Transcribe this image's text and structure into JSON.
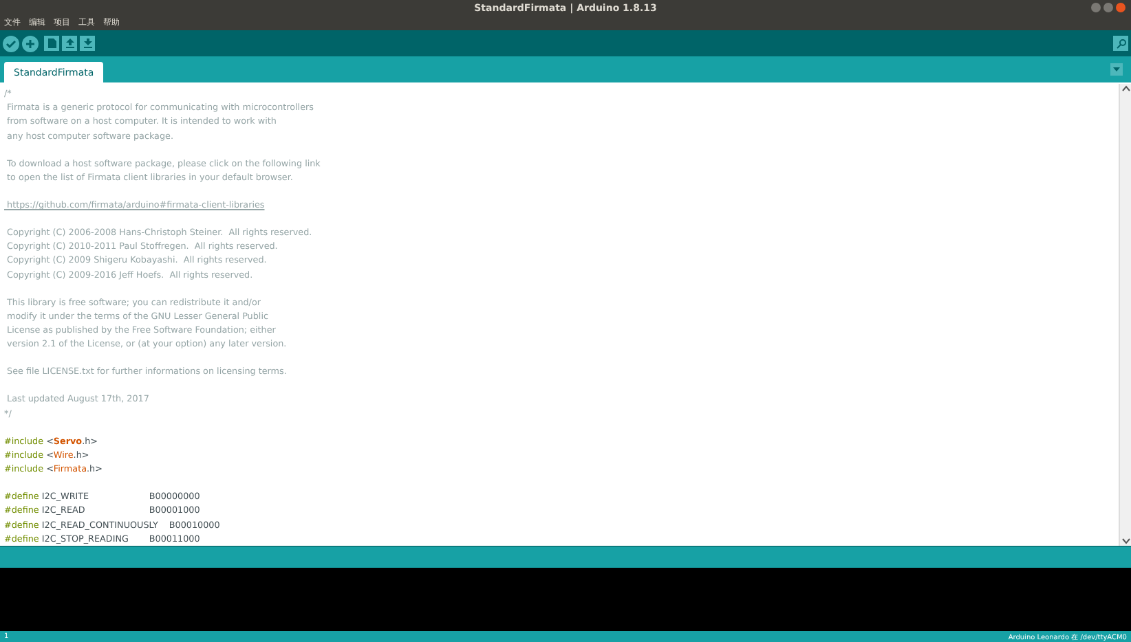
{
  "window": {
    "title": "StandardFirmata | Arduino 1.8.13"
  },
  "menu": [
    "文件",
    "编辑",
    "项目",
    "工具",
    "帮助"
  ],
  "tabs": [
    {
      "label": "StandardFirmata",
      "selected": true
    }
  ],
  "code": [
    {
      "kind": "comment",
      "text": "/*"
    },
    {
      "kind": "comment",
      "text": " Firmata is a generic protocol for communicating with microcontrollers"
    },
    {
      "kind": "comment",
      "text": " from software on a host computer. It is intended to work with"
    },
    {
      "kind": "comment",
      "text": " any host computer software package."
    },
    {
      "kind": "blank"
    },
    {
      "kind": "comment",
      "text": " To download a host software package, please click on the following link"
    },
    {
      "kind": "comment",
      "text": " to open the list of Firmata client libraries in your default browser."
    },
    {
      "kind": "blank"
    },
    {
      "kind": "link",
      "text": "https://github.com/firmata/arduino#firmata-client-libraries"
    },
    {
      "kind": "blank"
    },
    {
      "kind": "comment",
      "text": " Copyright (C) 2006-2008 Hans-Christoph Steiner.  All rights reserved."
    },
    {
      "kind": "comment",
      "text": " Copyright (C) 2010-2011 Paul Stoffregen.  All rights reserved."
    },
    {
      "kind": "comment",
      "text": " Copyright (C) 2009 Shigeru Kobayashi.  All rights reserved."
    },
    {
      "kind": "comment",
      "text": " Copyright (C) 2009-2016 Jeff Hoefs.  All rights reserved."
    },
    {
      "kind": "blank"
    },
    {
      "kind": "comment",
      "text": " This library is free software; you can redistribute it and/or"
    },
    {
      "kind": "comment",
      "text": " modify it under the terms of the GNU Lesser General Public"
    },
    {
      "kind": "comment",
      "text": " License as published by the Free Software Foundation; either"
    },
    {
      "kind": "comment",
      "text": " version 2.1 of the License, or (at your option) any later version."
    },
    {
      "kind": "blank"
    },
    {
      "kind": "comment",
      "text": " See file LICENSE.txt for further informations on licensing terms."
    },
    {
      "kind": "blank"
    },
    {
      "kind": "comment",
      "text": " Last updated August 17th, 2017"
    },
    {
      "kind": "comment",
      "text": "*/"
    },
    {
      "kind": "blank"
    },
    {
      "kind": "include",
      "keyword": "#include",
      "open": "<",
      "lib": "Servo",
      "close": ".h>",
      "bold": true
    },
    {
      "kind": "include",
      "keyword": "#include",
      "open": "<",
      "lib": "Wire",
      "close": ".h>",
      "bold": false
    },
    {
      "kind": "include",
      "keyword": "#include",
      "open": "<",
      "lib": "Firmata",
      "close": ".h>",
      "bold": false
    },
    {
      "kind": "blank"
    },
    {
      "kind": "define",
      "keyword": "#define",
      "name": "I2C_WRITE",
      "value": "B00000000"
    },
    {
      "kind": "define",
      "keyword": "#define",
      "name": "I2C_READ",
      "value": "B00001000"
    },
    {
      "kind": "define",
      "keyword": "#define",
      "name": "I2C_READ_CONTINUOUSLY",
      "value": "B00010000"
    },
    {
      "kind": "define",
      "keyword": "#define",
      "name": "I2C_STOP_READING",
      "value": "B00011000"
    }
  ],
  "status_bar": {
    "line": "1",
    "board": "Arduino Leonardo 在 /dev/ttyACM0"
  }
}
